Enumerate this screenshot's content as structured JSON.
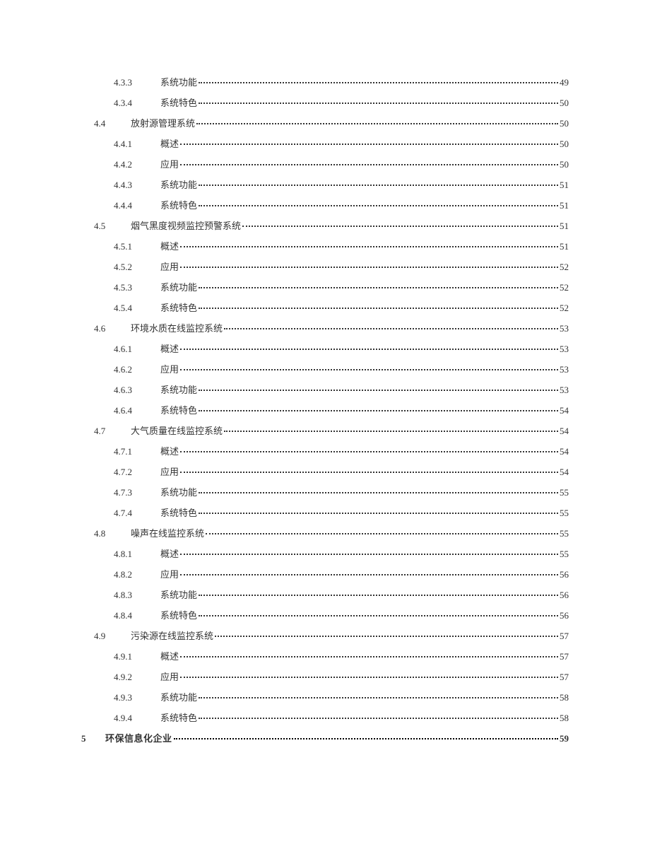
{
  "toc": [
    {
      "level": 3,
      "num": "4.3.3",
      "title": "系统功能",
      "page": "49"
    },
    {
      "level": 3,
      "num": "4.3.4",
      "title": "系统特色",
      "page": "50"
    },
    {
      "level": 2,
      "num": "4.4",
      "title": "放射源管理系统",
      "page": "50"
    },
    {
      "level": 3,
      "num": "4.4.1",
      "title": "概述",
      "page": "50"
    },
    {
      "level": 3,
      "num": "4.4.2",
      "title": "应用",
      "page": "50"
    },
    {
      "level": 3,
      "num": "4.4.3",
      "title": "系统功能",
      "page": "51"
    },
    {
      "level": 3,
      "num": "4.4.4",
      "title": "系统特色",
      "page": "51"
    },
    {
      "level": 2,
      "num": "4.5",
      "title": "烟气黑度视频监控预警系统",
      "page": "51"
    },
    {
      "level": 3,
      "num": "4.5.1",
      "title": "概述",
      "page": "51"
    },
    {
      "level": 3,
      "num": "4.5.2",
      "title": "应用",
      "page": "52"
    },
    {
      "level": 3,
      "num": "4.5.3",
      "title": "系统功能",
      "page": "52"
    },
    {
      "level": 3,
      "num": "4.5.4",
      "title": "系统特色",
      "page": "52"
    },
    {
      "level": 2,
      "num": "4.6",
      "title": "环境水质在线监控系统",
      "page": "53"
    },
    {
      "level": 3,
      "num": "4.6.1",
      "title": "概述",
      "page": "53"
    },
    {
      "level": 3,
      "num": "4.6.2",
      "title": "应用",
      "page": "53"
    },
    {
      "level": 3,
      "num": "4.6.3",
      "title": "系统功能",
      "page": "53"
    },
    {
      "level": 3,
      "num": "4.6.4",
      "title": "系统特色",
      "page": "54"
    },
    {
      "level": 2,
      "num": "4.7",
      "title": "大气质量在线监控系统",
      "page": "54"
    },
    {
      "level": 3,
      "num": "4.7.1",
      "title": "概述",
      "page": "54"
    },
    {
      "level": 3,
      "num": "4.7.2",
      "title": "应用",
      "page": "54"
    },
    {
      "level": 3,
      "num": "4.7.3",
      "title": "系统功能",
      "page": "55"
    },
    {
      "level": 3,
      "num": "4.7.4",
      "title": "系统特色",
      "page": "55"
    },
    {
      "level": 2,
      "num": "4.8",
      "title": "噪声在线监控系统",
      "page": "55"
    },
    {
      "level": 3,
      "num": "4.8.1",
      "title": "概述",
      "page": "55"
    },
    {
      "level": 3,
      "num": "4.8.2",
      "title": "应用",
      "page": "56"
    },
    {
      "level": 3,
      "num": "4.8.3",
      "title": "系统功能",
      "page": "56"
    },
    {
      "level": 3,
      "num": "4.8.4",
      "title": "系统特色",
      "page": "56"
    },
    {
      "level": 2,
      "num": "4.9",
      "title": "污染源在线监控系统",
      "page": "57"
    },
    {
      "level": 3,
      "num": "4.9.1",
      "title": "概述",
      "page": "57"
    },
    {
      "level": 3,
      "num": "4.9.2",
      "title": "应用",
      "page": "57"
    },
    {
      "level": 3,
      "num": "4.9.3",
      "title": "系统功能",
      "page": "58"
    },
    {
      "level": 3,
      "num": "4.9.4",
      "title": "系统特色",
      "page": "58"
    },
    {
      "level": 1,
      "num": "5",
      "title": "环保信息化企业",
      "page": "59"
    }
  ]
}
